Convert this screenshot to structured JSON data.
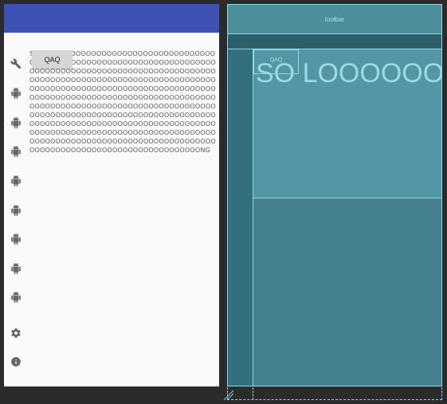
{
  "preview": {
    "qaq_label": "QAQ",
    "long_text": "SO LOOOOOOOOOOOOOOOOOOOOOOOOOOOOOOOOOOOOOOOOOOOOOOOOOOOOOOOOOOOOOOOOOOOOOOOOOOOOOOOOOOOOOOOOOOOOOOOOOOOOOOOOOOOOOOOOOOOOOOOOOOOOOOOOOOOOOOOOOOOOOOOOOOOOOOOOOOOOOOOOOOOOOOOOOOOOOOOOOOOOOOOOOOOOOOOOOOOOOOOOOOOOOOOOOOOOOOOOOOOOOOOOOOOOOOOOOOOOOOOOOOOOOOOOOOOOOOOOOOOOOOOOOOOOOOOOOOOOOOOOOOOOOOOOOOOOOOOOOOOOOOOOOOOOOOOOOOOOOOOOOOOOOOOOOOOOOOOOOOOOOOOOOOOOOOOOOOOOOOOOOOOOOOOOOOOOOOOOOOOOOOOOOOOOOOOOOOOOOOOOOOOOOOOOOOOOOOOOOOOOOOOOOONG",
    "icons": [
      "wrench-icon",
      "android-icon",
      "android-icon",
      "android-icon",
      "android-icon",
      "android-icon",
      "android-icon",
      "android-icon",
      "android-icon",
      "settings-icon",
      "info-icon"
    ],
    "colors": {
      "appbar": "#3f51b5",
      "background": "#fafafa",
      "button": "#d6d6d6"
    }
  },
  "blueprint": {
    "toolbar_label": "toolbar",
    "qaq_label": "QAQ",
    "big_text": "SO LOOOOOOOOOOOOOOOOOOOOOOOOOOOOOOOOOOOOOOOOOOOOOOOOOOOOOOOOOOOOOOOOOOOOOOOOOOOOOOOOOOOOOOOOOOOOOOOOOOOOOOOOOOOOOOOOOOOOOOOOOOOOOOOOOOOOOOOOOOOOOOOOOOOOOOOOOOOOOOOOOOOOOOOOOOOOOOOOOOOOOOOOOOOOOOOOOOOOOOOOOOOOOOOOOOOOOOOOOOOOOOOOOOOOOOOOOOOOOOOOOOOOOOOOOOOOOOOOOOOOOOOOOOOOOOOOOOOOOOOOOOOOOOOOOOOOOOOOOOOOOOOOOOOOOOOOOOOOOOOOOOOOOOOOOOOOOOOOOOOOOOOOOOOOOOOOOOOOOOOOOOOOOOOOOOOOOOOOOOOOOOOOOOOOOOOOOOOOOOOOOOOOOOOOOOOOOOOOOOOOONG",
    "colors": {
      "surface": "#44808f",
      "outline": "#8fd6e6"
    }
  }
}
